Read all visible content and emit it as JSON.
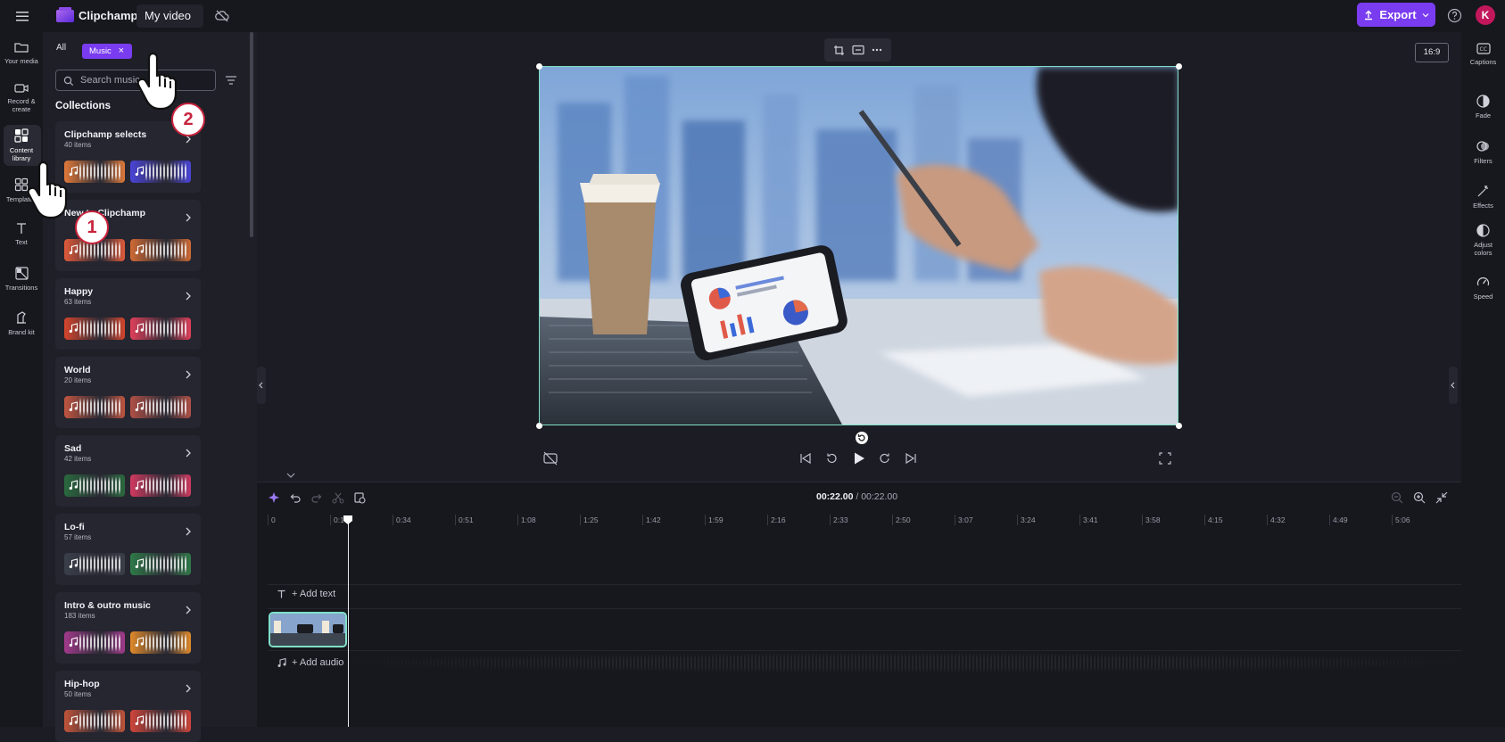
{
  "topbar": {
    "app_name": "Clipchamp",
    "project_name": "My video",
    "export_label": "Export",
    "avatar_initial": "K"
  },
  "left_rail": {
    "items": [
      {
        "label": "Your media",
        "icon": "folder-icon"
      },
      {
        "label": "Record & create",
        "icon": "camera-icon"
      },
      {
        "label": "Content library",
        "icon": "library-icon",
        "active": true
      },
      {
        "label": "Templates",
        "icon": "templates-icon"
      },
      {
        "label": "Text",
        "icon": "text-icon"
      },
      {
        "label": "Transitions",
        "icon": "transitions-icon"
      },
      {
        "label": "Brand kit",
        "icon": "brand-kit-icon"
      }
    ]
  },
  "library": {
    "filter_all": "All",
    "filter_music": "Music",
    "search_placeholder": "Search music",
    "collections_title": "Collections",
    "collections": [
      {
        "title": "Clipchamp selects",
        "count": "40 items",
        "thumb_a": "#e07a3a",
        "thumb_b": "#4a44d8"
      },
      {
        "title": "New to Clipchamp",
        "count": "",
        "thumb_a": "#e05a3a",
        "thumb_b": "#d06a34"
      },
      {
        "title": "Happy",
        "count": "63 items",
        "thumb_a": "#d4452d",
        "thumb_b": "#e0405a"
      },
      {
        "title": "World",
        "count": "20 items",
        "thumb_a": "#c05540",
        "thumb_b": "#b05046"
      },
      {
        "title": "Sad",
        "count": "42 items",
        "thumb_a": "#2a6a3e",
        "thumb_b": "#d03a60"
      },
      {
        "title": "Lo-fi",
        "count": "57 items",
        "thumb_a": "#3a3f4a",
        "thumb_b": "#2f7a48"
      },
      {
        "title": "Intro & outro music",
        "count": "183 items",
        "thumb_a": "#a23a8c",
        "thumb_b": "#e08a2a"
      },
      {
        "title": "Hip-hop",
        "count": "50 items",
        "thumb_a": "#c0543a",
        "thumb_b": "#d0453a"
      }
    ]
  },
  "preview": {
    "aspect_ratio": "16:9"
  },
  "right_rail": {
    "items": [
      {
        "label": "Captions",
        "icon": "captions-icon"
      },
      {
        "label": "Fade",
        "icon": "fade-icon"
      },
      {
        "label": "Filters",
        "icon": "filters-icon"
      },
      {
        "label": "Effects",
        "icon": "effects-icon"
      },
      {
        "label": "Adjust colors",
        "icon": "adjust-colors-icon"
      },
      {
        "label": "Speed",
        "icon": "speed-icon"
      }
    ]
  },
  "timeline": {
    "current_time": "00:22.00",
    "total_time": "/ 00:22.00",
    "ruler_ticks": [
      "0",
      "0:17",
      "0:34",
      "0:51",
      "1:08",
      "1:25",
      "1:42",
      "1:59",
      "2:16",
      "2:33",
      "2:50",
      "3:07",
      "3:24",
      "3:41",
      "3:58",
      "4:15",
      "4:32",
      "4:49",
      "5:06"
    ],
    "add_text_label": "+ Add text",
    "add_audio_label": "+ Add audio"
  },
  "tutorial_badges": {
    "step_1": "1",
    "step_2": "2"
  },
  "colors": {
    "accent": "#7a3cf0",
    "selection": "#7fe0c6",
    "badge_border": "#c8233c"
  }
}
